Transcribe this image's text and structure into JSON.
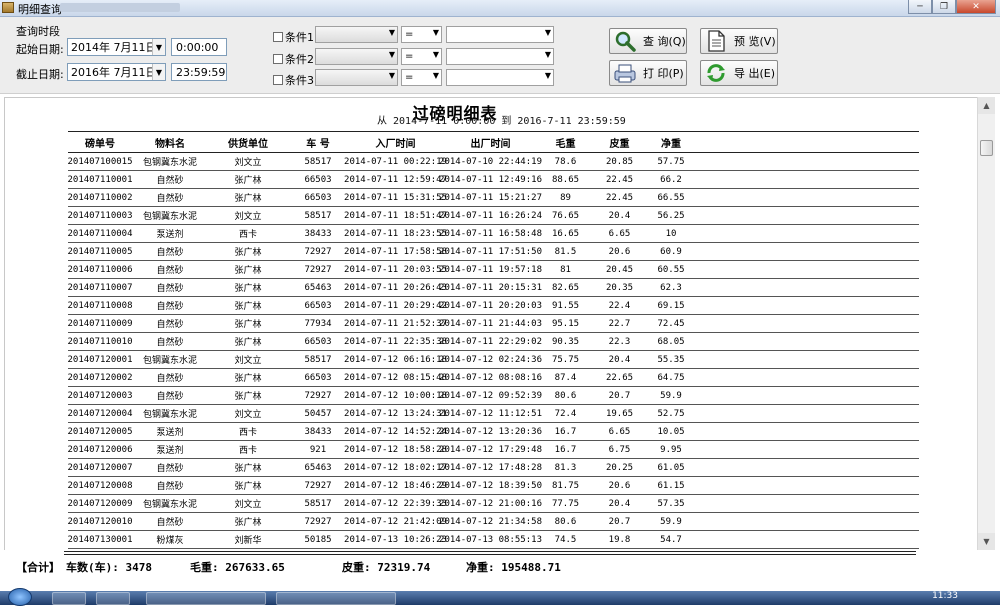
{
  "window": {
    "title": "明细查询"
  },
  "filters": {
    "group_label": "查询时段",
    "start_label": "起始日期:",
    "start_date": "2014年 7月11日",
    "start_time": "0:00:00",
    "end_label": "截止日期:",
    "end_date": "2016年 7月11日",
    "end_time": "23:59:59",
    "conditions": [
      {
        "label": "条件1",
        "operator": "="
      },
      {
        "label": "条件2",
        "operator": "="
      },
      {
        "label": "条件3",
        "operator": "="
      }
    ]
  },
  "buttons": {
    "query": "查 询(Q)",
    "preview": "预 览(V)",
    "print": "打 印(P)",
    "export": "导 出(E)"
  },
  "report": {
    "title": "过磅明细表",
    "subtitle": "从 2014-7-11 0:00:00 到 2016-7-11 23:59:59",
    "columns": [
      "磅单号",
      "物料名",
      "供货单位",
      "车 号",
      "入厂时间",
      "出厂时间",
      "毛重",
      "皮重",
      "净重"
    ],
    "rows": [
      [
        "201407100015",
        "包钢冀东水泥",
        "刘文立",
        "58517",
        "2014-07-11 00:22:19",
        "2014-07-10 22:44:19",
        "78.6",
        "20.85",
        "57.75"
      ],
      [
        "201407110001",
        "自然砂",
        "张广林",
        "66503",
        "2014-07-11 12:59:47",
        "2014-07-11 12:49:16",
        "88.65",
        "22.45",
        "66.2"
      ],
      [
        "201407110002",
        "自然砂",
        "张广林",
        "66503",
        "2014-07-11 15:31:55",
        "2014-07-11 15:21:27",
        "89",
        "22.45",
        "66.55"
      ],
      [
        "201407110003",
        "包钢冀东水泥",
        "刘文立",
        "58517",
        "2014-07-11 18:51:47",
        "2014-07-11 16:26:24",
        "76.65",
        "20.4",
        "56.25"
      ],
      [
        "201407110004",
        "泵送剂",
        "西卡",
        "38433",
        "2014-07-11 18:23:55",
        "2014-07-11 16:58:48",
        "16.65",
        "6.65",
        "10"
      ],
      [
        "201407110005",
        "自然砂",
        "张广林",
        "72927",
        "2014-07-11 17:58:58",
        "2014-07-11 17:51:50",
        "81.5",
        "20.6",
        "60.9"
      ],
      [
        "201407110006",
        "自然砂",
        "张广林",
        "72927",
        "2014-07-11 20:03:55",
        "2014-07-11 19:57:18",
        "81",
        "20.45",
        "60.55"
      ],
      [
        "201407110007",
        "自然砂",
        "张广林",
        "65463",
        "2014-07-11 20:26:43",
        "2014-07-11 20:15:31",
        "82.65",
        "20.35",
        "62.3"
      ],
      [
        "201407110008",
        "自然砂",
        "张广林",
        "66503",
        "2014-07-11 20:29:42",
        "2014-07-11 20:20:03",
        "91.55",
        "22.4",
        "69.15"
      ],
      [
        "201407110009",
        "自然砂",
        "张广林",
        "77934",
        "2014-07-11 21:52:37",
        "2014-07-11 21:44:03",
        "95.15",
        "22.7",
        "72.45"
      ],
      [
        "201407110010",
        "自然砂",
        "张广林",
        "66503",
        "2014-07-11 22:35:38",
        "2014-07-11 22:29:02",
        "90.35",
        "22.3",
        "68.05"
      ],
      [
        "201407120001",
        "包钢冀东水泥",
        "刘文立",
        "58517",
        "2014-07-12 06:16:18",
        "2014-07-12 02:24:36",
        "75.75",
        "20.4",
        "55.35"
      ],
      [
        "201407120002",
        "自然砂",
        "张广林",
        "66503",
        "2014-07-12 08:15:48",
        "2014-07-12 08:08:16",
        "87.4",
        "22.65",
        "64.75"
      ],
      [
        "201407120003",
        "自然砂",
        "张广林",
        "72927",
        "2014-07-12 10:00:18",
        "2014-07-12 09:52:39",
        "80.6",
        "20.7",
        "59.9"
      ],
      [
        "201407120004",
        "包钢冀东水泥",
        "刘文立",
        "50457",
        "2014-07-12 13:24:31",
        "2014-07-12 11:12:51",
        "72.4",
        "19.65",
        "52.75"
      ],
      [
        "201407120005",
        "泵送剂",
        "西卡",
        "38433",
        "2014-07-12 14:52:24",
        "2014-07-12 13:20:36",
        "16.7",
        "6.65",
        "10.05"
      ],
      [
        "201407120006",
        "泵送剂",
        "西卡",
        "921",
        "2014-07-12 18:58:28",
        "2014-07-12 17:29:48",
        "16.7",
        "6.75",
        "9.95"
      ],
      [
        "201407120007",
        "自然砂",
        "张广林",
        "65463",
        "2014-07-12 18:02:17",
        "2014-07-12 17:48:28",
        "81.3",
        "20.25",
        "61.05"
      ],
      [
        "201407120008",
        "自然砂",
        "张广林",
        "72927",
        "2014-07-12 18:46:29",
        "2014-07-12 18:39:50",
        "81.75",
        "20.6",
        "61.15"
      ],
      [
        "201407120009",
        "包钢冀东水泥",
        "刘文立",
        "58517",
        "2014-07-12 22:39:33",
        "2014-07-12 21:00:16",
        "77.75",
        "20.4",
        "57.35"
      ],
      [
        "201407120010",
        "自然砂",
        "张广林",
        "72927",
        "2014-07-12 21:42:09",
        "2014-07-12 21:34:58",
        "80.6",
        "20.7",
        "59.9"
      ],
      [
        "201407130001",
        "粉煤灰",
        "刘新华",
        "50185",
        "2014-07-13 10:26:23",
        "2014-07-13 08:55:13",
        "74.5",
        "19.8",
        "54.7"
      ]
    ]
  },
  "summary": {
    "lead": "【合计】",
    "count": "车数(车): 3478",
    "gross": "毛重: 267633.65",
    "tare": "皮重: 72319.74",
    "net": "净重: 195488.71"
  },
  "taskbar": {
    "clock": "11:33"
  },
  "colors": {
    "titlebar": "#c9d7ea",
    "panel": "#ededed",
    "taskbar": "#1f3c69"
  }
}
